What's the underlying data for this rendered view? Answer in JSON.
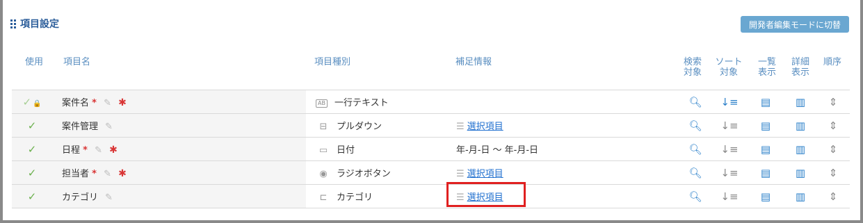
{
  "section_title": "項目設定",
  "dev_mode_button": "開発者編集モードに切替",
  "headers": {
    "use": "使用",
    "item_name": "項目名",
    "item_type": "項目種別",
    "extra_info": "補足情報",
    "search_1": "検索",
    "search_2": "対象",
    "sort_1": "ソート",
    "sort_2": "対象",
    "list_1": "一覧",
    "list_2": "表示",
    "detail_1": "詳細",
    "detail_2": "表示",
    "order": "順序"
  },
  "rows": [
    {
      "name": "案件名",
      "required": "*",
      "locked": true,
      "type": "一行テキスト",
      "type_icon": "text-field-icon",
      "info": ""
    },
    {
      "name": "案件管理",
      "required": "",
      "locked": false,
      "type": "プルダウン",
      "type_icon": "dropdown-icon",
      "info": "選択項目"
    },
    {
      "name": "日程",
      "required": "*",
      "locked": false,
      "type": "日付",
      "type_icon": "calendar-icon",
      "info": "年-月-日 ～ 年-月-日"
    },
    {
      "name": "担当者",
      "required": "*",
      "locked": false,
      "type": "ラジオボタン",
      "type_icon": "radio-icon",
      "info": "選択項目"
    },
    {
      "name": "カテゴリ",
      "required": "",
      "locked": false,
      "type": "カテゴリ",
      "type_icon": "category-icon",
      "info": "選択項目"
    }
  ],
  "type_badge": "AB",
  "colors": {
    "accent": "#2b5d9a",
    "button": "#6aa7d1",
    "highlight": "#e02020",
    "check": "#6ab04c"
  }
}
